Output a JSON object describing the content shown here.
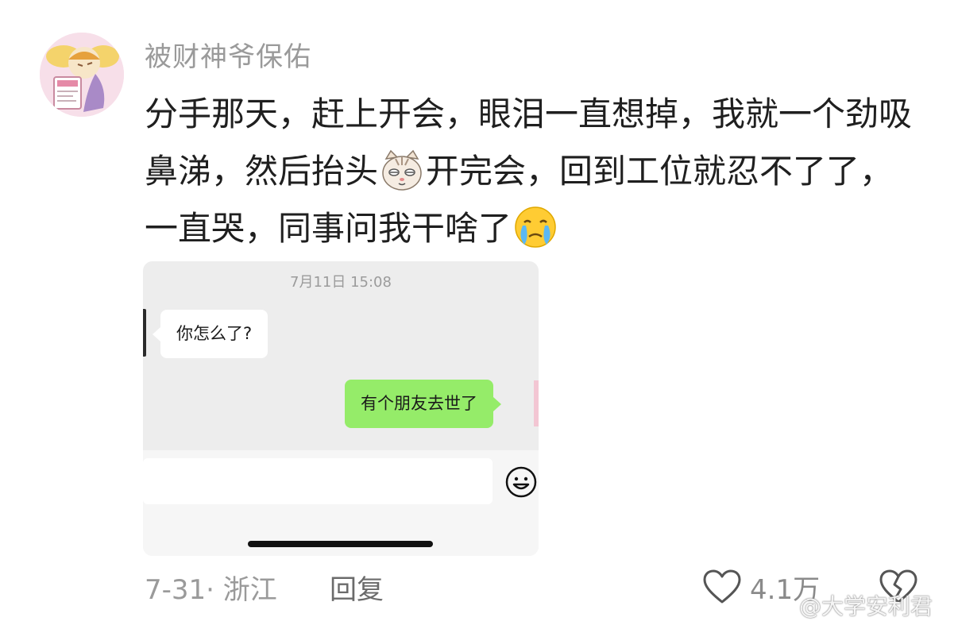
{
  "comment": {
    "username": "被财神爷保佑",
    "text_part1": "分手那天，赶上开会，眼泪一直想掉，我就一个劲吸鼻涕，然后抬头",
    "text_part2": "开完会，回到工位就忍不了了，一直哭，同事问我干啥了",
    "emoji_1": "cat-face-emoji",
    "emoji_2": "crying-face-emoji"
  },
  "chat_screenshot": {
    "timestamp": "7月11日 15:08",
    "messages": [
      {
        "side": "left",
        "text": "你怎么了?"
      },
      {
        "side": "right",
        "text": "有个朋友去世了"
      }
    ],
    "emoji_button_icon": "smiley-icon"
  },
  "footer": {
    "date_location": "7-31· 浙江",
    "reply_label": "回复",
    "like_count": "4.1万",
    "like_icon": "heart-icon",
    "dislike_icon": "broken-heart-icon"
  },
  "watermark": "@大学安利君",
  "colors": {
    "sent_bubble": "#95ec69",
    "chat_bg": "#ededed",
    "muted_text": "#9a9a9a"
  }
}
